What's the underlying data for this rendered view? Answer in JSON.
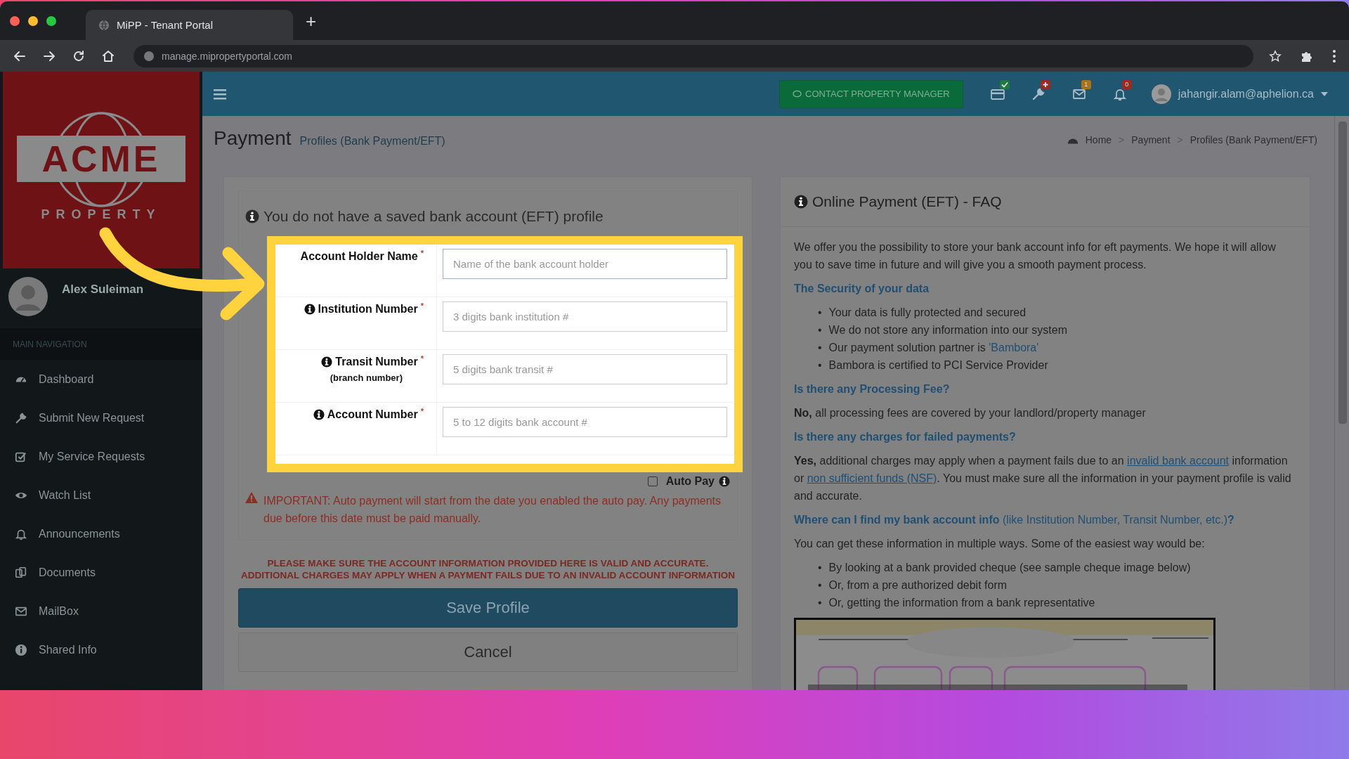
{
  "browser": {
    "tab_title": "MiPP - Tenant Portal",
    "new_tab": "+",
    "url": "manage.mipropertyportal.com"
  },
  "sidebar": {
    "logo": {
      "name": "ACME",
      "tagline": "PROPERTY"
    },
    "user_name": "Alex Suleiman",
    "nav_header": "MAIN NAVIGATION",
    "items": [
      {
        "label": "Dashboard"
      },
      {
        "label": "Submit New Request"
      },
      {
        "label": "My Service Requests"
      },
      {
        "label": "Watch List"
      },
      {
        "label": "Announcements"
      },
      {
        "label": "Documents"
      },
      {
        "label": "MailBox"
      },
      {
        "label": "Shared Info"
      }
    ]
  },
  "header": {
    "contact_button": "CONTACT PROPERTY MANAGER",
    "icons": [
      {
        "kind": "check",
        "color": "#1e7a3e"
      },
      {
        "kind": "plus",
        "color": "#9a2a22"
      },
      {
        "kind": "count",
        "count": "1",
        "color": "#a8741a"
      },
      {
        "kind": "count",
        "count": "0",
        "color": "#9a2a22"
      }
    ],
    "user_email": "jahangir.alam@aphelion.ca"
  },
  "page": {
    "title": "Payment",
    "subtitle": "Profiles (Bank Payment/EFT)",
    "breadcrumb": [
      {
        "text": "Home"
      },
      {
        "separator": ">",
        "text": "Payment"
      },
      {
        "separator": ">",
        "text": "Profiles (Bank Payment/EFT)"
      }
    ]
  },
  "form": {
    "notice": "You do not have a saved bank account (EFT) profile",
    "fields": [
      {
        "label": "Account Holder Name",
        "info": false,
        "required_mark": "*",
        "placeholder": "Name of the bank account holder",
        "focused": true
      },
      {
        "label": "Institution Number",
        "info": true,
        "required_mark": "*",
        "placeholder": "3 digits bank institution #",
        "focused": false
      },
      {
        "label": "Transit Number",
        "sublabel": "(branch number)",
        "info": true,
        "required_mark": "*",
        "placeholder": "5 digits bank transit #",
        "focused": false
      },
      {
        "label": "Account Number",
        "info": true,
        "required_mark": "*",
        "placeholder": "5 to 12 digits bank account #",
        "focused": false
      }
    ],
    "auto_pay": {
      "label": "Auto Pay",
      "checked": false
    },
    "important": "IMPORTANT: Auto payment will start from the date you enabled the auto pay. Any payments due before this date must be paid manually.",
    "warning": "PLEASE MAKE SURE THE ACCOUNT INFORMATION PROVIDED HERE IS VALID AND ACCURATE. ADDITIONAL CHARGES MAY APPLY WHEN A PAYMENT FAILS DUE TO AN INVALID ACCOUNT INFORMATION",
    "save_button": "Save Profile",
    "cancel_button": "Cancel"
  },
  "faq": {
    "title": "Online Payment (EFT) - FAQ",
    "blocks": [
      {
        "kind": "paragraph",
        "segments": [
          {
            "kind": "text",
            "text": "We offer you the possibility to store your bank account info for eft payments. We hope it will allow you to save time in future and will give you a smooth payment process."
          }
        ]
      },
      {
        "kind": "heading",
        "text": "The Security of your data"
      },
      {
        "kind": "list",
        "items": [
          {
            "bullet": "•",
            "segments": [
              {
                "kind": "text",
                "text": "Your data is fully protected and secured"
              }
            ]
          },
          {
            "bullet": "•",
            "segments": [
              {
                "kind": "text",
                "text": "We do not store any information into our system"
              }
            ]
          },
          {
            "bullet": "•",
            "segments": [
              {
                "kind": "text",
                "text": "Our payment solution partner is "
              },
              {
                "kind": "link",
                "text": "'Bambora'"
              }
            ]
          },
          {
            "bullet": "•",
            "segments": [
              {
                "kind": "text",
                "text": "Bambora is certified to PCI Service Provider"
              }
            ]
          }
        ]
      },
      {
        "kind": "heading",
        "text": "Is there any Processing Fee?"
      },
      {
        "kind": "paragraph",
        "segments": [
          {
            "kind": "bold",
            "text": "No,"
          },
          {
            "kind": "text",
            "text": " all processing fees are covered by your landlord/property manager"
          }
        ]
      },
      {
        "kind": "heading",
        "text": "Is there any charges for failed payments?"
      },
      {
        "kind": "paragraph",
        "segments": [
          {
            "kind": "bold",
            "text": "Yes,"
          },
          {
            "kind": "text",
            "text": " additional charges may apply when a payment fails due to an "
          },
          {
            "kind": "link",
            "text": "invalid bank account"
          },
          {
            "kind": "text",
            "text": " information or "
          },
          {
            "kind": "link",
            "text": "non sufficient funds (NSF)"
          },
          {
            "kind": "text",
            "text": ". You must make sure all the information in your payment profile is valid and accurate."
          }
        ]
      },
      {
        "kind": "heading",
        "text": "**Where can I find my bank account info** (like Institution Number, Transit Number, etc.)**?**"
      },
      {
        "kind": "paragraph",
        "segments": [
          {
            "kind": "text",
            "text": "You can get these information in multiple ways. Some of the easiest way would be:"
          }
        ]
      },
      {
        "kind": "list",
        "items": [
          {
            "bullet": "•",
            "segments": [
              {
                "kind": "text",
                "text": "By looking at a bank provided cheque (see sample cheque image below)"
              }
            ]
          },
          {
            "bullet": "•",
            "segments": [
              {
                "kind": "text",
                "text": "Or, from a pre authorized debit form"
              }
            ]
          },
          {
            "bullet": "•",
            "segments": [
              {
                "kind": "text",
                "text": "Or, getting the information from a bank representative"
              }
            ]
          }
        ]
      },
      {
        "kind": "picture"
      }
    ]
  }
}
